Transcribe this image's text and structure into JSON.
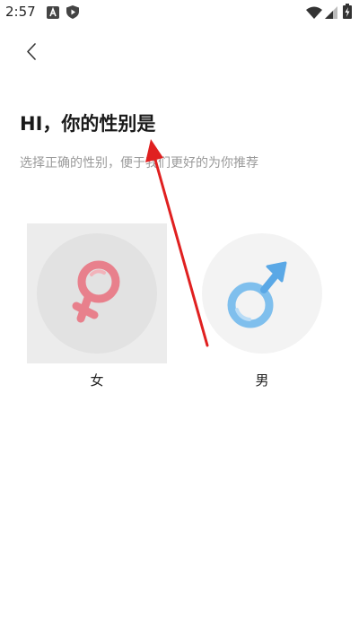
{
  "status_bar": {
    "time": "2:57",
    "icons_left": [
      "a-box-icon",
      "shield-play-icon"
    ],
    "icons_right": [
      "wifi-icon",
      "signal-icon",
      "battery-charging-icon"
    ]
  },
  "header": {
    "back_icon": "chevron-left-icon",
    "title": "HI，你的性别是",
    "subtitle": "选择正确的性别，便于我们更好的为你推荐"
  },
  "options": [
    {
      "label": "女",
      "icon": "female-symbol-icon",
      "selected": true,
      "color": "#e8808c"
    },
    {
      "label": "男",
      "icon": "male-symbol-icon",
      "selected": false,
      "color": "#7fbfed"
    }
  ],
  "colors": {
    "selected_bg": "#ececec",
    "arrow": "#e02020"
  }
}
